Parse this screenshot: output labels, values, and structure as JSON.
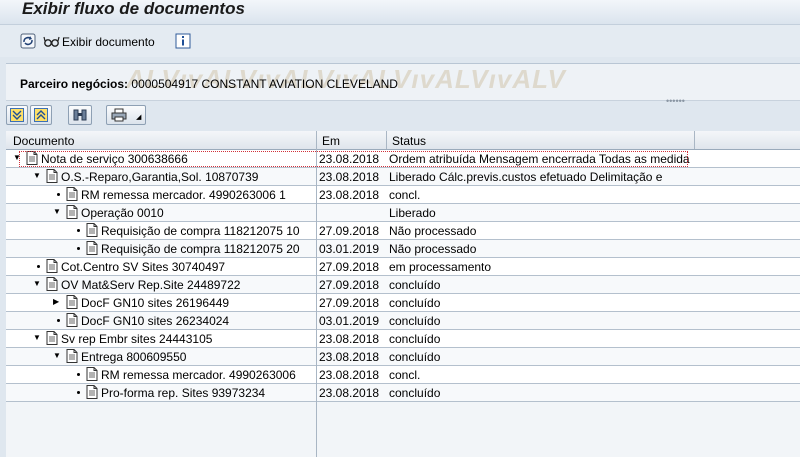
{
  "window": {
    "title": "Exibir fluxo de documentos"
  },
  "toolbar": {
    "display_doc_label": "Exibir documento"
  },
  "header": {
    "partner_label": "Parceiro negócios:",
    "partner_value": "0000504917 CONSTANT AVIATION CLEVELAND",
    "watermark": "ALV"
  },
  "grid": {
    "columns": [
      "Documento",
      "Em",
      "Status"
    ],
    "rows": [
      {
        "level": 0,
        "toggle": "expanded",
        "document": "Nota de serviço 300638666",
        "date": "23.08.2018",
        "status": "Ordem atribuída Mensagem encerrada Todas as medida"
      },
      {
        "level": 1,
        "toggle": "expanded",
        "document": "O.S.-Reparo,Garantia,Sol. 10870739",
        "date": "23.08.2018",
        "status": "Liberado Cálc.previs.custos efetuado Delimitação e"
      },
      {
        "level": 2,
        "toggle": "leaf",
        "document": "RM remessa mercador. 4990263006 1",
        "date": "23.08.2018",
        "status": "concl."
      },
      {
        "level": 2,
        "toggle": "expanded",
        "document": "Operação 0010",
        "date": "",
        "status": "Liberado"
      },
      {
        "level": 3,
        "toggle": "leaf",
        "document": "Requisição de compra 118212075 10",
        "date": "27.09.2018",
        "status": "Não processado"
      },
      {
        "level": 3,
        "toggle": "leaf",
        "document": "Requisição de compra 118212075 20",
        "date": "03.01.2019",
        "status": "Não processado"
      },
      {
        "level": 1,
        "toggle": "leaf",
        "document": "Cot.Centro SV Sites 30740497",
        "date": "27.09.2018",
        "status": "em processamento"
      },
      {
        "level": 1,
        "toggle": "expanded",
        "document": "OV Mat&Serv Rep.Site 24489722",
        "date": "27.09.2018",
        "status": "concluído"
      },
      {
        "level": 2,
        "toggle": "collapsed",
        "document": "DocF GN10 sites 26196449",
        "date": "27.09.2018",
        "status": "concluído"
      },
      {
        "level": 2,
        "toggle": "leaf",
        "document": "DocF GN10 sites 26234024",
        "date": "03.01.2019",
        "status": "concluído"
      },
      {
        "level": 1,
        "toggle": "expanded",
        "document": "Sv rep Embr sites 24443105",
        "date": "23.08.2018",
        "status": "concluído"
      },
      {
        "level": 2,
        "toggle": "expanded",
        "document": "Entrega 800609550",
        "date": "23.08.2018",
        "status": "concluído"
      },
      {
        "level": 3,
        "toggle": "leaf",
        "document": "RM remessa mercador. 4990263006",
        "date": "23.08.2018",
        "status": "concl."
      },
      {
        "level": 3,
        "toggle": "leaf",
        "document": "Pro-forma rep. Sites 93973234",
        "date": "23.08.2018",
        "status": "concluído"
      }
    ]
  }
}
